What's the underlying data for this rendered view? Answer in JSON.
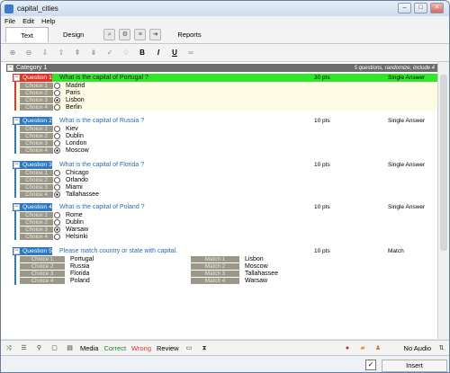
{
  "window": {
    "title": "capital_cities"
  },
  "menu": [
    "File",
    "Edit",
    "Help"
  ],
  "tabs": {
    "text": "Text",
    "design": "Design",
    "reports": "Reports"
  },
  "category": {
    "label": "Category 1",
    "info": "5 questions, randomize, include 4"
  },
  "questions": [
    {
      "label": "Question 1",
      "text": "What is the capital of Portugal ?",
      "points": "30 pts",
      "type": "Single Answer",
      "choices": [
        {
          "label": "Choice 1",
          "text": "Madrid"
        },
        {
          "label": "Choice 2",
          "text": "Paris"
        },
        {
          "label": "Choice 3",
          "text": "Lisbon"
        },
        {
          "label": "Choice 4",
          "text": "Berlin"
        }
      ]
    },
    {
      "label": "Question 2",
      "text": "What is the capital of Russia ?",
      "points": "10 pts",
      "type": "Single Answer",
      "choices": [
        {
          "label": "Choice 1",
          "text": "Kiev"
        },
        {
          "label": "Choice 2",
          "text": "Dublin"
        },
        {
          "label": "Choice 3",
          "text": "London"
        },
        {
          "label": "Choice 4",
          "text": "Moscow"
        }
      ]
    },
    {
      "label": "Question 3",
      "text": "What is the capital  of Florida ?",
      "points": "10 pts",
      "type": "Single Answer",
      "choices": [
        {
          "label": "Choice 1",
          "text": "Chicago"
        },
        {
          "label": "Choice 2",
          "text": "Orlando"
        },
        {
          "label": "Choice 3",
          "text": "Miami"
        },
        {
          "label": "Choice 4",
          "text": "Tallahassee"
        }
      ]
    },
    {
      "label": "Question 4",
      "text": "What is the capital of Poland ?",
      "points": "10 pts",
      "type": "Single Answer",
      "choices": [
        {
          "label": "Choice 1",
          "text": "Rome"
        },
        {
          "label": "Choice 2",
          "text": "Dublin"
        },
        {
          "label": "Choice 3",
          "text": "Warsaw"
        },
        {
          "label": "Choice 4",
          "text": "Helsinki"
        }
      ]
    },
    {
      "label": "Question 5",
      "text": "Please match country or state with capital.",
      "points": "10 pts",
      "type": "Match",
      "choices": [
        {
          "label": "Choice 1",
          "text": "Portugal"
        },
        {
          "label": "Choice 2",
          "text": "Russia"
        },
        {
          "label": "Choice 3",
          "text": "Florida"
        },
        {
          "label": "Choice 4",
          "text": "Poland"
        }
      ],
      "matches": [
        {
          "label": "Match 1",
          "text": "Lisbon"
        },
        {
          "label": "Match 2",
          "text": "Moscow"
        },
        {
          "label": "Match 3",
          "text": "Tallahassee"
        },
        {
          "label": "Match 4",
          "text": "Warsaw"
        }
      ]
    }
  ],
  "bottom": {
    "media": "Media",
    "correct": "Correct",
    "wrong": "Wrong",
    "review": "Review",
    "audio": "No Audio"
  },
  "status": {
    "insert": "Insert"
  },
  "colors": {
    "correct": "#1a8a1a",
    "wrong": "#e0352b",
    "selected_question": "#e0352b",
    "question": "#2d79c2",
    "highlight": "#33e62b"
  }
}
